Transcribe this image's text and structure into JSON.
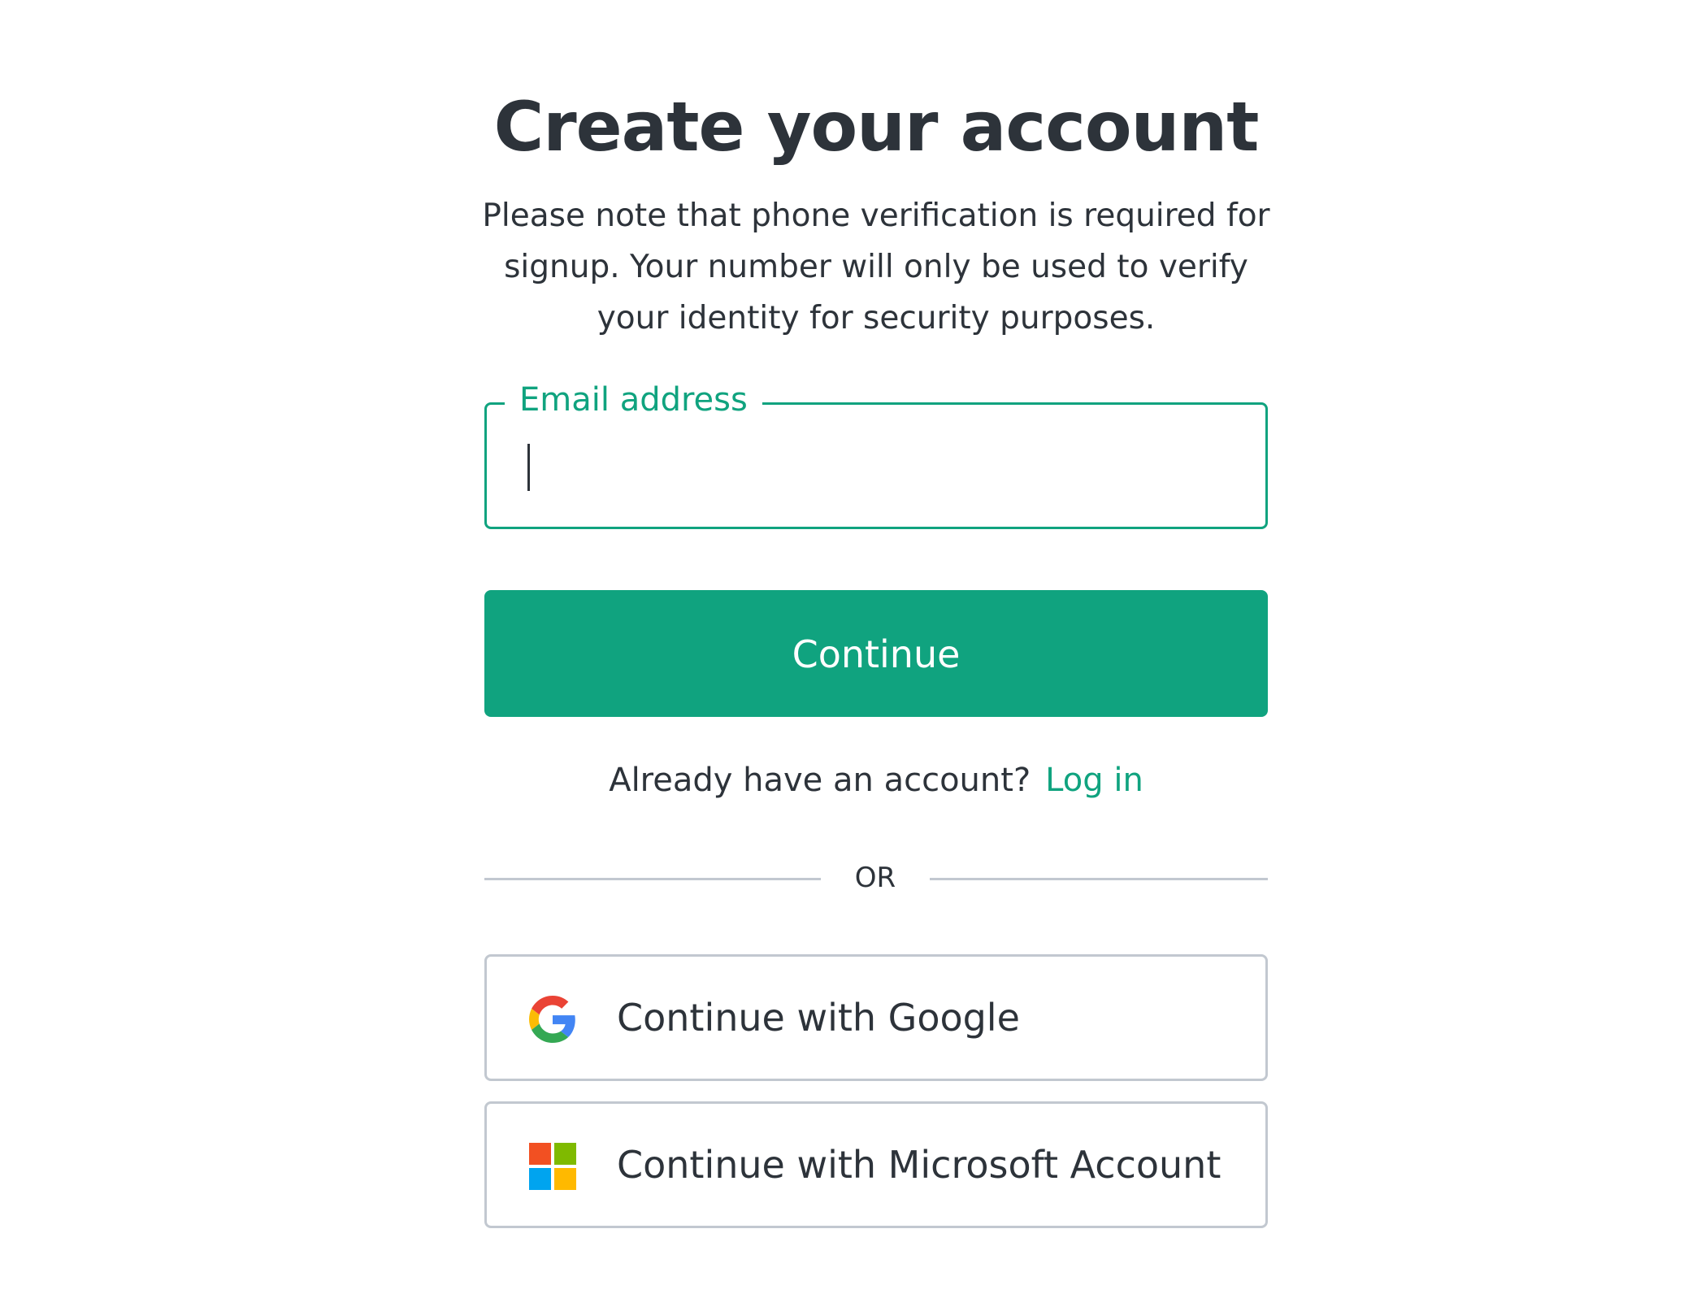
{
  "page": {
    "title": "Create your account",
    "subtitle": "Please note that phone verification is required for signup. Your number will only be used to verify your identity for security purposes."
  },
  "email_field": {
    "label": "Email address",
    "value": ""
  },
  "primary_button": {
    "label": "Continue"
  },
  "login_prompt": {
    "text": "Already have an account?",
    "link_label": "Log in"
  },
  "divider": {
    "label": "OR"
  },
  "social": {
    "google": {
      "label": "Continue with Google",
      "icon": "google-icon"
    },
    "microsoft": {
      "label": "Continue with Microsoft Account",
      "icon": "microsoft-icon"
    }
  },
  "colors": {
    "accent": "#10a37f",
    "text": "#2d333a",
    "border": "#c2c8d0",
    "background": "#ffffff"
  }
}
